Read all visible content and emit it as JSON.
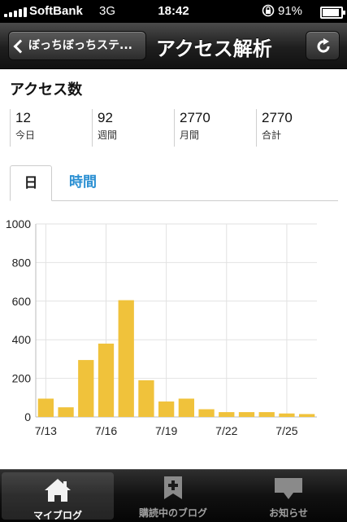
{
  "status_bar": {
    "carrier": "SoftBank",
    "network": "3G",
    "time": "18:42",
    "battery": "91%",
    "battery_level": 0.91,
    "icons": [
      "signal-bars-icon",
      "rotation-lock-icon",
      "battery-icon"
    ]
  },
  "nav": {
    "back_label": "ぼっちぼっちステ...",
    "title": "アクセス解析",
    "refresh_icon": "refresh-icon"
  },
  "access": {
    "title": "アクセス数",
    "stats": [
      {
        "value": "12",
        "label": "今日"
      },
      {
        "value": "92",
        "label": "週間"
      },
      {
        "value": "2770",
        "label": "月間"
      },
      {
        "value": "2770",
        "label": "合計"
      }
    ]
  },
  "tabs": [
    {
      "label": "日",
      "active": true
    },
    {
      "label": "時間",
      "active": false
    }
  ],
  "chart_data": {
    "type": "bar",
    "categories": [
      "7/13",
      "7/14",
      "7/15",
      "7/16",
      "7/17",
      "7/18",
      "7/19",
      "7/20",
      "7/21",
      "7/22",
      "7/23",
      "7/24",
      "7/25",
      "7/26"
    ],
    "values": [
      95,
      50,
      295,
      380,
      605,
      190,
      80,
      95,
      40,
      25,
      25,
      25,
      18,
      15
    ],
    "x_tick_labels": [
      "7/13",
      "7/16",
      "7/19",
      "7/22",
      "7/25"
    ],
    "y_ticks": [
      0,
      200,
      400,
      600,
      800,
      1000
    ],
    "ylim": [
      0,
      1000
    ],
    "grid": true,
    "bar_color": "#f0c23b",
    "title": "",
    "xlabel": "",
    "ylabel": ""
  },
  "tabbar": {
    "items": [
      {
        "label": "マイブログ",
        "icon": "home-icon",
        "selected": true
      },
      {
        "label": "購読中のブログ",
        "icon": "bookmark-add-icon",
        "selected": false
      },
      {
        "label": "お知らせ",
        "icon": "speech-bubble-icon",
        "selected": false
      }
    ]
  }
}
